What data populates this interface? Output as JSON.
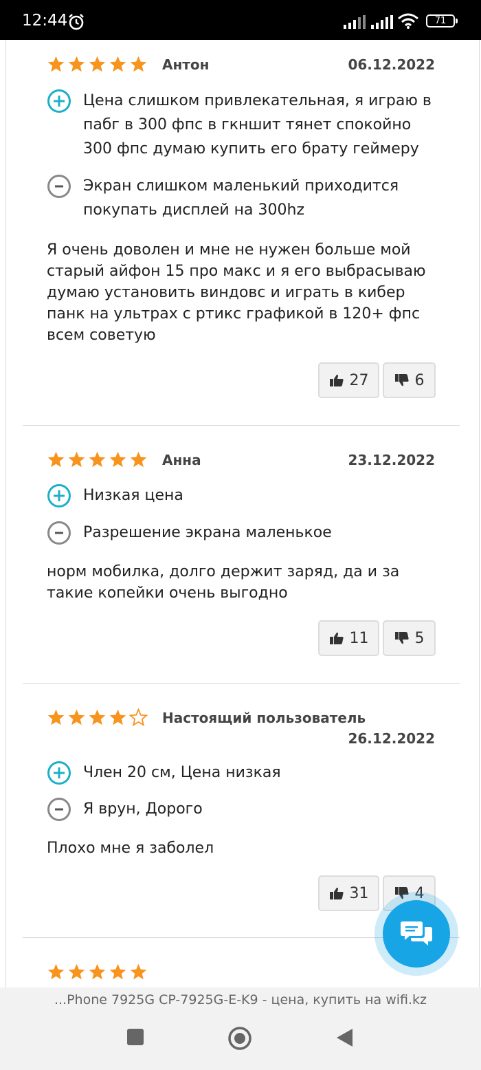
{
  "status_bar": {
    "time": "12:44",
    "battery": "71"
  },
  "reviews": [
    {
      "rating": 5,
      "author": "Антон",
      "date": "06.12.2022",
      "pros": "Цена слишком привлекательная, я играю в пабг в 300 фпс в гкншит тянет спокойно 300 фпс думаю купить его брату геймеру",
      "cons": "Экран слишком маленький приходится покупать дисплей на 300hz",
      "text": "Я очень доволен и мне не нужен больше мой старый айфон 15 про макс и я его выбрасываю думаю установить виндовс и играть в кибер панк на ультрах с ртикс графикой в 120+ фпс всем советую",
      "likes": "27",
      "dislikes": "6"
    },
    {
      "rating": 5,
      "author": "Анна",
      "date": "23.12.2022",
      "pros": "Низкая цена",
      "cons": "Разрешение экрана маленькое",
      "text": "норм мобилка, долго держит заряд, да и за такие копейки очень выгодно",
      "likes": "11",
      "dislikes": "5"
    },
    {
      "rating": 4,
      "author": "Настоящий пользователь",
      "date": "26.12.2022",
      "pros": "Член 20 см, Цена низкая",
      "cons": "Я врун, Дорого",
      "text": "Плохо мне я заболел",
      "likes": "31",
      "dislikes": "4"
    },
    {
      "rating": 5
    }
  ],
  "url_bar": {
    "title": "...Phone 7925G CP-7925G-E-K9 - цена, купить на wifi.kz"
  },
  "colors": {
    "star": "#f7941d",
    "plus": "#1bb0c8",
    "minus": "#888888",
    "fab": "#17a5e6"
  },
  "icons": [
    "alarm-icon",
    "signal-icon",
    "wifi-icon",
    "battery-icon",
    "star-icon",
    "plus-circle-icon",
    "minus-circle-icon",
    "thumbs-up-icon",
    "thumbs-down-icon",
    "chat-icon",
    "square-icon",
    "home-circle-icon",
    "back-triangle-icon"
  ]
}
